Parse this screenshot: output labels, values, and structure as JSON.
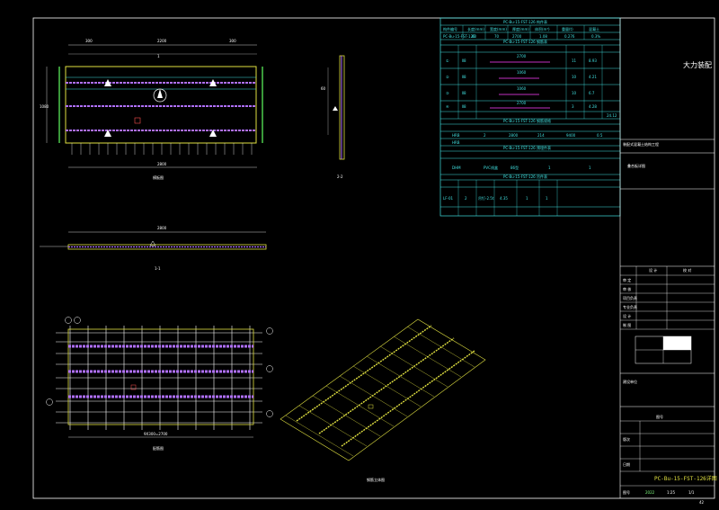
{
  "drawing": {
    "views": {
      "plan_title": "模板图",
      "elevation_title": "1-1",
      "side_title": "2-2",
      "rebar_title": "配筋图",
      "iso_title": "钢筋立体图",
      "dim_total": "2800",
      "dim_top_a": "300",
      "dim_top_b": "2200",
      "dim_top_c": "300",
      "dim_bottom": "2800",
      "dim_width": "1080",
      "dim_rebar_bottom": "9X300=2700",
      "side_dim": "60",
      "mark_1": "1",
      "mark_2": "2"
    },
    "tables": {
      "table1_title": "PC-Bu-15-FST-126 构件表",
      "table1_headers": [
        "构件编号",
        "长度(mm)",
        "宽度(mm)",
        "厚度(mm)",
        "体积(m³)",
        "重量(t)",
        "混凝土"
      ],
      "table1_row": [
        "PC-Bu-15-FST-126",
        "60",
        "70",
        "2700",
        "1.08",
        "0.276",
        "0.3%"
      ],
      "table2_title": "PC-Bu-15-FST-126 钢筋表",
      "table2_rows": [
        {
          "mark": "①",
          "spec": "Ⅱ8",
          "len": "2700",
          "qty": "11",
          "wt": "8.93"
        },
        {
          "mark": "②",
          "spec": "Ⅱ8",
          "len": "1060",
          "qty": "10",
          "wt": "4.21"
        },
        {
          "mark": "③",
          "spec": "Ⅱ8",
          "len": "1060",
          "qty": "10",
          "wt": "6.7"
        },
        {
          "mark": "④",
          "spec": "Ⅱ8",
          "len": "2700",
          "qty": "3",
          "wt": "4.28"
        }
      ],
      "table2_total": "24.12",
      "table3_title": "PC-Bu-15-FST-126 钢筋规格",
      "table3_rows": [
        [
          "HRB",
          "2",
          "2800",
          "214",
          "9400",
          "0.5"
        ],
        [
          "HRB",
          "",
          "",
          "",
          "",
          ""
        ]
      ],
      "table4_title": "PC-Bu-15-FST-126 预埋件表",
      "table4_row": [
        "DHM",
        "PVC线盒",
        "86型",
        "1",
        "1"
      ],
      "table5_title": "PC-Bu-15-FST-126 吊件表",
      "table5_row": [
        "LF-01",
        "2",
        "吊钉-2.5t",
        "4.35",
        "1",
        "1"
      ]
    },
    "title_block": {
      "company": "大力装配",
      "project_label": "装配式混凝土结构工程",
      "drawing_desc": "叠合板详图",
      "stage_a": "设 计",
      "stage_b": "校 对",
      "row_labels": [
        "审 定",
        "审 核",
        "项目负责",
        "专业负责",
        "设 计",
        "制 图"
      ],
      "field_a": "图号",
      "field_b": "版次",
      "date_label": "日期",
      "drawing_no": "PC-Bu-15-FST-126详图",
      "sheet_label": "图号",
      "sheet_value": "1/1",
      "version": "2022",
      "owner": "建设单位",
      "scale": "1:25",
      "page_no": "42"
    }
  }
}
